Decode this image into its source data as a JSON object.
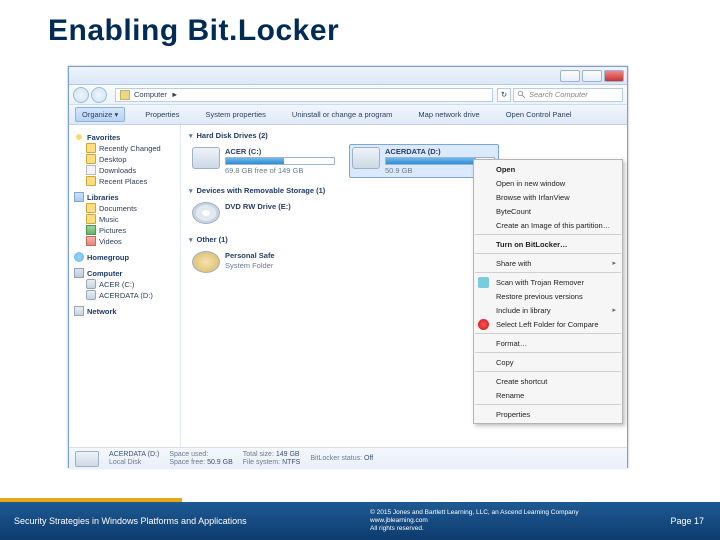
{
  "slide": {
    "title": "Enabling Bit.Locker"
  },
  "explorer": {
    "breadcrumb": {
      "root": "Computer",
      "chev": "►"
    },
    "search_placeholder": "Search Computer",
    "toolbar": {
      "organize": "Organize ▾",
      "properties": "Properties",
      "sysprops": "System properties",
      "uninstall": "Uninstall or change a program",
      "mapdrive": "Map network drive",
      "controlpanel": "Open Control Panel"
    },
    "sidebar": {
      "favorites": "Favorites",
      "recently": "Recently Changed",
      "desktop": "Desktop",
      "downloads": "Downloads",
      "recent": "Recent Places",
      "libraries": "Libraries",
      "documents": "Documents",
      "music": "Music",
      "pictures": "Pictures",
      "videos": "Videos",
      "homegroup": "Homegroup",
      "computer": "Computer",
      "drive_c": "ACER (C:)",
      "drive_d": "ACERDATA (D:)",
      "network": "Network"
    },
    "groups": {
      "hdd": "Hard Disk Drives (2)",
      "removable": "Devices with Removable Storage (1)",
      "other": "Other (1)"
    },
    "drives": {
      "c": {
        "name": "ACER (C:)",
        "free": "69.8 GB free of 149 GB",
        "fill_pct": 54
      },
      "d": {
        "name": "ACERDATA (D:)",
        "free": "50.9 GB",
        "fill_pct": 83
      },
      "dvd": {
        "name": "DVD RW Drive (E:)"
      },
      "safe": {
        "name": "Personal Safe",
        "sub": "System Folder"
      }
    },
    "details": {
      "title": "ACERDATA (D:)",
      "localdisk": "Local Disk",
      "space_used": "Space used:",
      "space_free_lab": "Space free:",
      "space_free": "50.9 GB",
      "total_lab": "Total size:",
      "total": "149 GB",
      "fs_lab": "File system:",
      "fs": "NTFS",
      "bl_lab": "BitLocker status:",
      "bl": "Off"
    }
  },
  "context_menu": {
    "open": "Open",
    "open_new": "Open in new window",
    "browse_irfan": "Browse with IrfanView",
    "bytecount": "ByteCount",
    "create_image": "Create an Image of this partition…",
    "turn_on_bl": "Turn on BitLocker…",
    "share_with": "Share with",
    "scan_trojan": "Scan with Trojan Remover",
    "restore": "Restore previous versions",
    "include": "Include in library",
    "select_left": "Select Left Folder for Compare",
    "format": "Format…",
    "copy": "Copy",
    "create_shortcut": "Create shortcut",
    "rename": "Rename",
    "properties": "Properties"
  },
  "footer": {
    "left": "Security Strategies in Windows Platforms and Applications",
    "copyright": "© 2015 Jones and Bartlett Learning, LLC, an Ascend Learning Company",
    "url": "www.jblearning.com",
    "rights": "All rights reserved.",
    "page": "Page 17"
  }
}
